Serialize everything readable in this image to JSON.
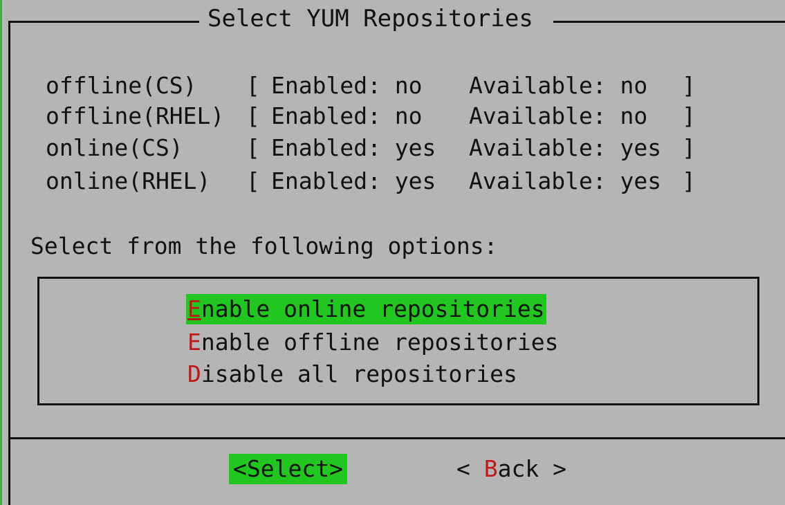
{
  "dialog": {
    "title": "Select YUM Repositories"
  },
  "repositories": [
    {
      "name": "offline(CS)",
      "enabled": "Enabled: no",
      "available": "Available: no"
    },
    {
      "name": "offline(RHEL)",
      "enabled": "Enabled: no",
      "available": "Available: no"
    },
    {
      "name": "online(CS)",
      "enabled": "Enabled: yes",
      "available": "Available: yes"
    },
    {
      "name": "online(RHEL)",
      "enabled": "Enabled: yes",
      "available": "Available: yes"
    }
  ],
  "bracket_open": "[",
  "bracket_close": "]",
  "options_label": "Select from the following options:",
  "options": [
    {
      "hotkey": "E",
      "rest": "nable online repositories",
      "selected": true
    },
    {
      "hotkey": "E",
      "rest": "nable offline repositories",
      "selected": false
    },
    {
      "hotkey": "D",
      "rest": "isable all repositories",
      "selected": false
    }
  ],
  "buttons": {
    "select_label": "<Select>",
    "back_open": "< ",
    "back_hotkey": "B",
    "back_rest": "ack >"
  },
  "colors": {
    "background": "#b5b5b5",
    "highlight": "#21c621",
    "hotkey": "#c01818",
    "frame": "#111111"
  }
}
